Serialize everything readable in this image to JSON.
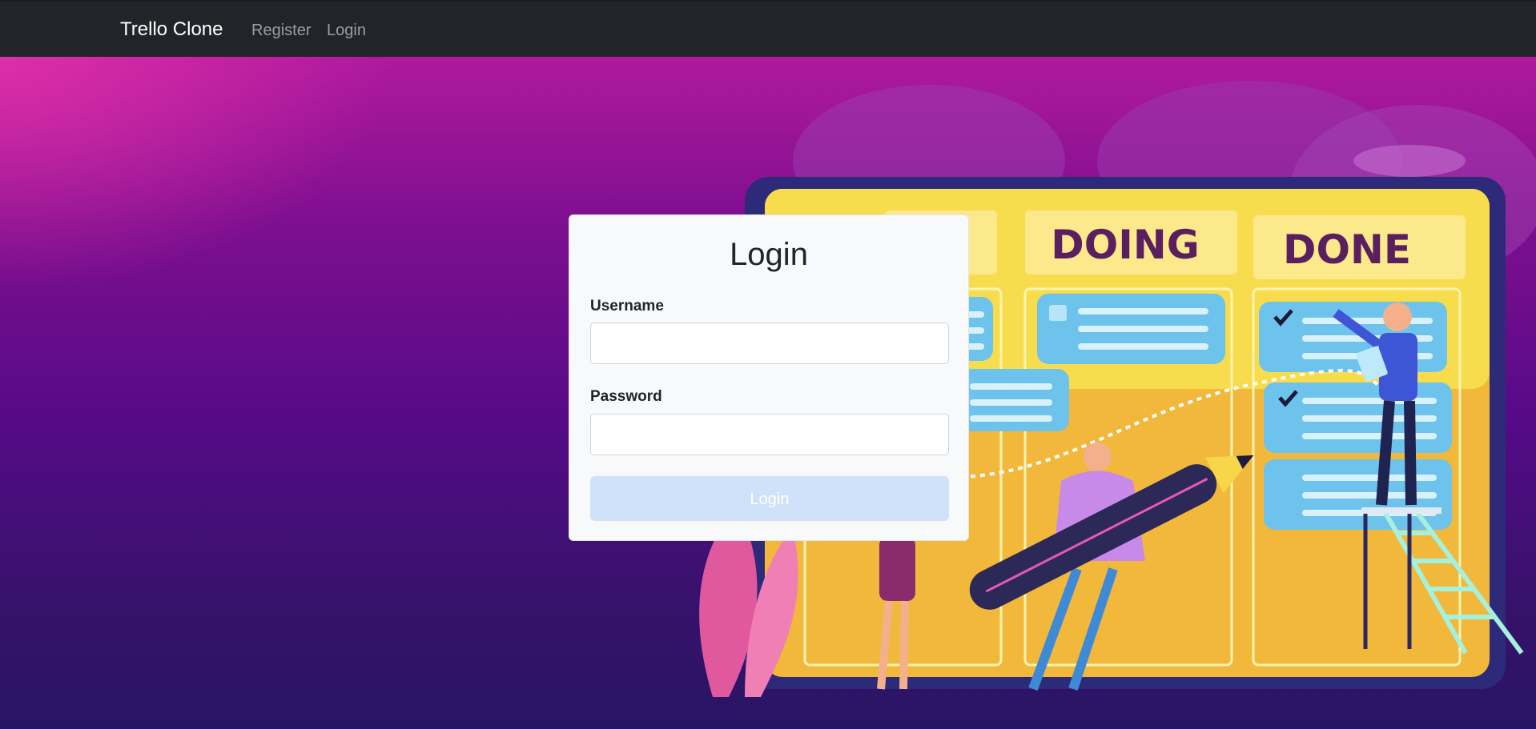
{
  "navbar": {
    "brand": "Trello Clone",
    "links": [
      {
        "label": "Register"
      },
      {
        "label": "Login"
      }
    ]
  },
  "hero": {
    "board_columns": [
      "DOING",
      "DONE"
    ],
    "colors": {
      "navbar_bg": "#212529",
      "board_yellow": "#f7d64a",
      "card_blue": "#6ec3ec",
      "hero_purple": "#550a86"
    }
  },
  "login_form": {
    "title": "Login",
    "username_label": "Username",
    "username_value": "",
    "password_label": "Password",
    "password_value": "",
    "submit_label": "Login"
  }
}
